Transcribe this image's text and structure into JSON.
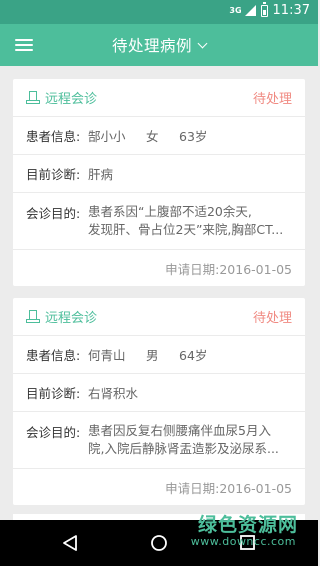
{
  "status_bar": {
    "network": "3G",
    "time": "11:37"
  },
  "app_bar": {
    "title": "待处理病例"
  },
  "cases": [
    {
      "type": "远程会诊",
      "status": "待处理",
      "patient_label": "患者信息:",
      "patient_name": "郜小小",
      "patient_gender": "女",
      "patient_age": "63岁",
      "diagnosis_label": "目前诊断:",
      "diagnosis": "肝病",
      "purpose_label": "会诊目的:",
      "purpose_lines": [
        "患者系因“上腹部不适20余天,",
        "发现肝、骨占位2天”来院,胸部CT..."
      ],
      "date": "申请日期:2016-01-05"
    },
    {
      "type": "远程会诊",
      "status": "待处理",
      "patient_label": "患者信息:",
      "patient_name": "何青山",
      "patient_gender": "男",
      "patient_age": "64岁",
      "diagnosis_label": "目前诊断:",
      "diagnosis": "右肾积水",
      "purpose_label": "会诊目的:",
      "purpose_lines": [
        "患者因反复右侧腰痛伴血尿5月入",
        "院,入院后静脉肾盂造影及泌尿系..."
      ],
      "date": "申请日期:2016-01-05"
    }
  ],
  "watermark": {
    "text": "绿色资源网",
    "url": "www.downcc.com"
  },
  "colors": {
    "accent": "#4dbe9b",
    "status_bar": "#3aa386",
    "pending": "#f08a82"
  }
}
